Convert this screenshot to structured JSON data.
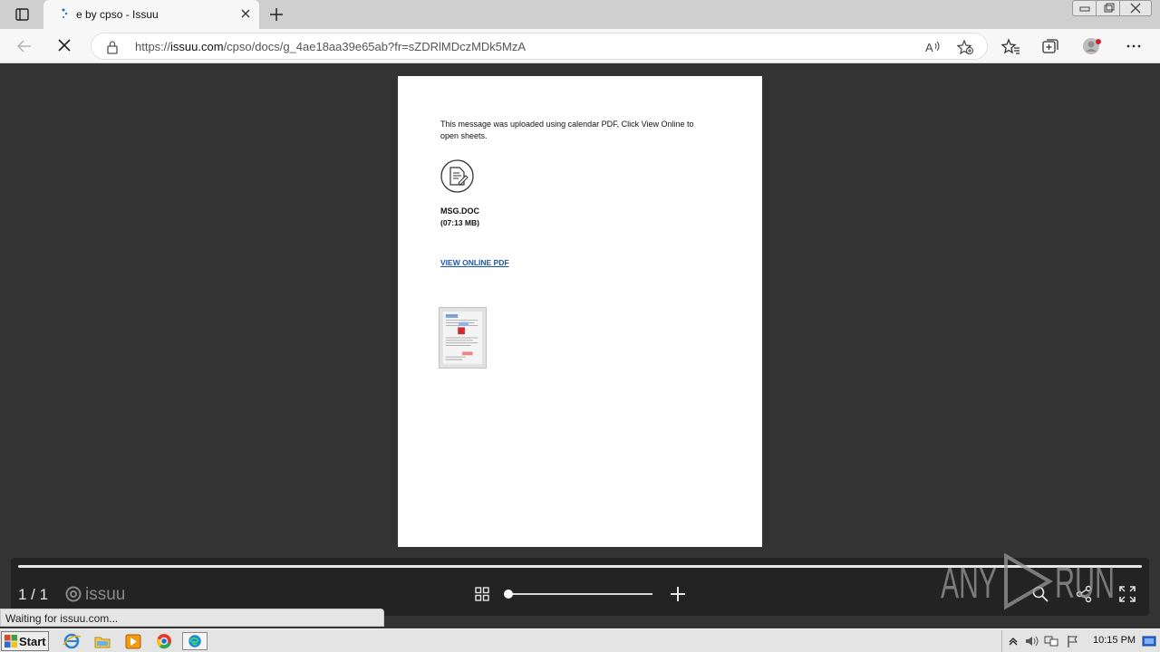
{
  "browser": {
    "tab_title": "e by cpso - Issuu",
    "url_prefix": "https://",
    "url_host": "issuu.com",
    "url_path": "/cpso/docs/g_4ae18aa39e65ab?fr=sZDRlMDczMDk5MzA",
    "status_text": "Waiting for issuu.com..."
  },
  "document": {
    "message": "This message was uploaded using calendar PDF, Click View Online to open sheets.",
    "file_name": "MSG.DOC",
    "file_size": "(07:13 MB)",
    "view_link": "VIEW ONLINE PDF"
  },
  "viewer_controls": {
    "page_counter": "1 / 1",
    "brand": "issuu",
    "zoom_level": 0
  },
  "watermark": {
    "text": "ANY RUN"
  },
  "taskbar": {
    "start_label": "Start",
    "clock": "10:15 PM"
  },
  "colors": {
    "viewer_bg": "#333333",
    "control_bar": "#232323",
    "link": "#1d55b5"
  }
}
